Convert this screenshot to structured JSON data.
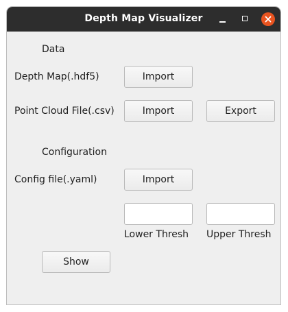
{
  "window": {
    "title": "Depth Map Visualizer",
    "controls": {
      "minimize": "minimize-icon",
      "maximize": "maximize-icon",
      "close": "close-icon",
      "close_color": "#e95420"
    }
  },
  "data_section": {
    "heading": "Data",
    "depth_map": {
      "label": "Depth Map(.hdf5)",
      "import_label": "Import"
    },
    "point_cloud": {
      "label": "Point Cloud File(.csv)",
      "import_label": "Import",
      "export_label": "Export"
    }
  },
  "config_section": {
    "heading": "Configuration",
    "config_file": {
      "label": "Config file(.yaml)",
      "import_label": "Import"
    },
    "lower_thresh": {
      "value": "",
      "label": "Lower Thresh"
    },
    "upper_thresh": {
      "value": "",
      "label": "Upper Thresh"
    }
  },
  "actions": {
    "show_label": "Show"
  }
}
